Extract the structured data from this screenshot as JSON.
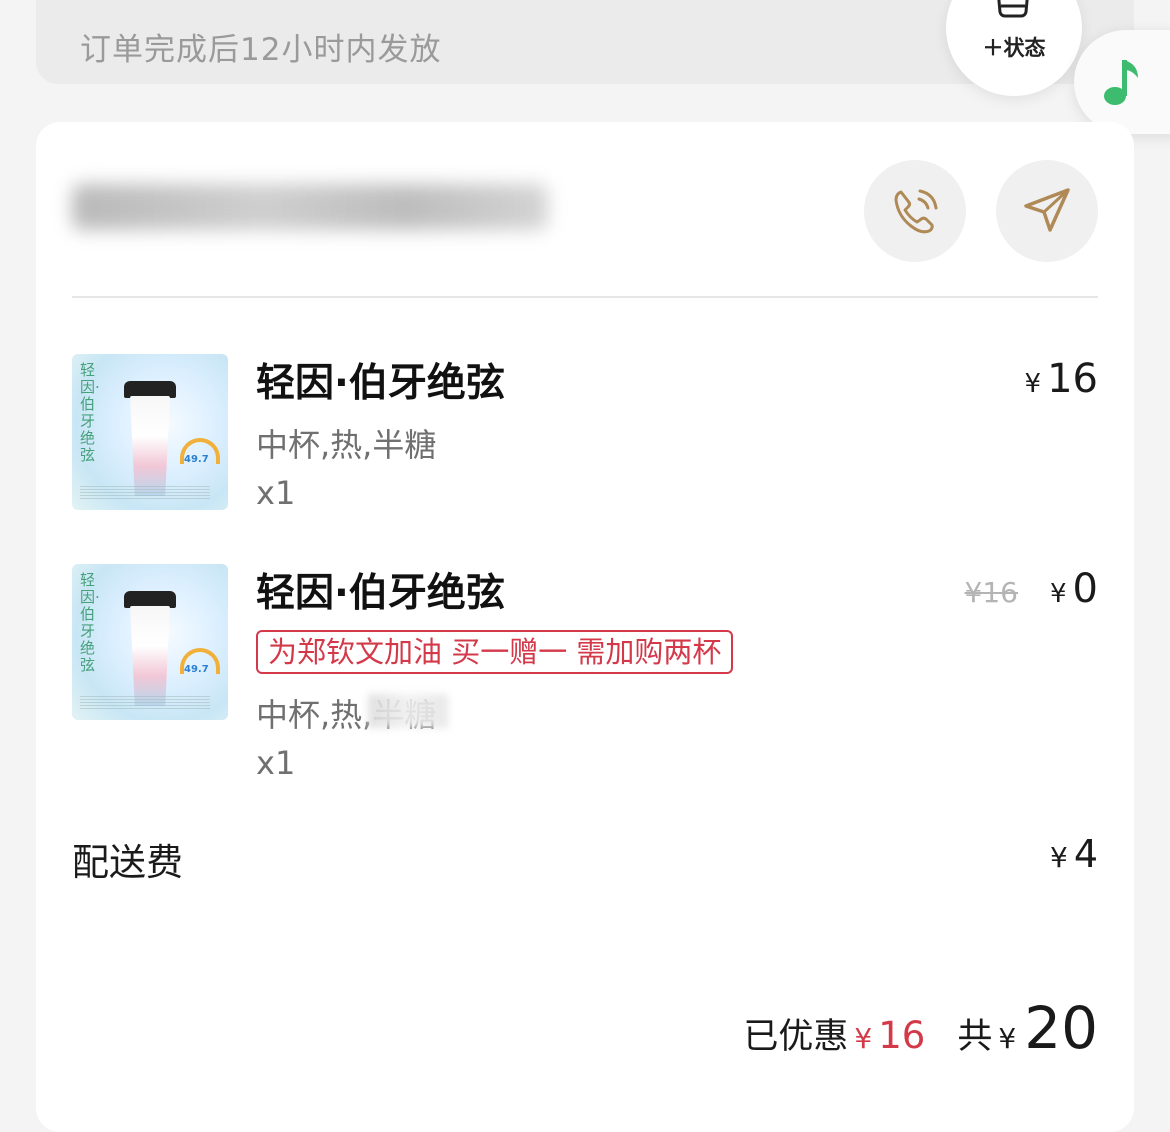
{
  "header": {
    "notice": "订单完成后12小时内发放",
    "status_button_label": "＋状态"
  },
  "store": {
    "name": "",
    "accent_color": "#b08a56"
  },
  "items": [
    {
      "name": "轻因·伯牙绝弦",
      "spec": "中杯,热,半糖",
      "qty": "x1",
      "currency": "¥",
      "price": "16",
      "thumb_text": "轻因·伯牙绝弦",
      "thumb_gauge": "49.7"
    },
    {
      "name": "轻因·伯牙绝弦",
      "promo": "为郑钦文加油 买一赠一 需加购两杯",
      "spec": "中杯,热,半糖",
      "qty": "x1",
      "old_price": "¥16",
      "currency": "¥",
      "price": "0",
      "thumb_text": "轻因·伯牙绝弦",
      "thumb_gauge": "49.7"
    }
  ],
  "delivery": {
    "label": "配送费",
    "currency": "¥",
    "price": "4"
  },
  "summary": {
    "discount_label": "已优惠",
    "discount_currency": "¥",
    "discount_value": "16",
    "total_label": "共",
    "total_currency": "¥",
    "total_value": "20"
  },
  "colors": {
    "promo_red": "#d4394a",
    "music_green": "#3dbb6e",
    "icon_gold": "#b08a56"
  },
  "icons": [
    "cup-icon",
    "music-note-icon",
    "phone-icon",
    "navigation-arrow-icon"
  ]
}
